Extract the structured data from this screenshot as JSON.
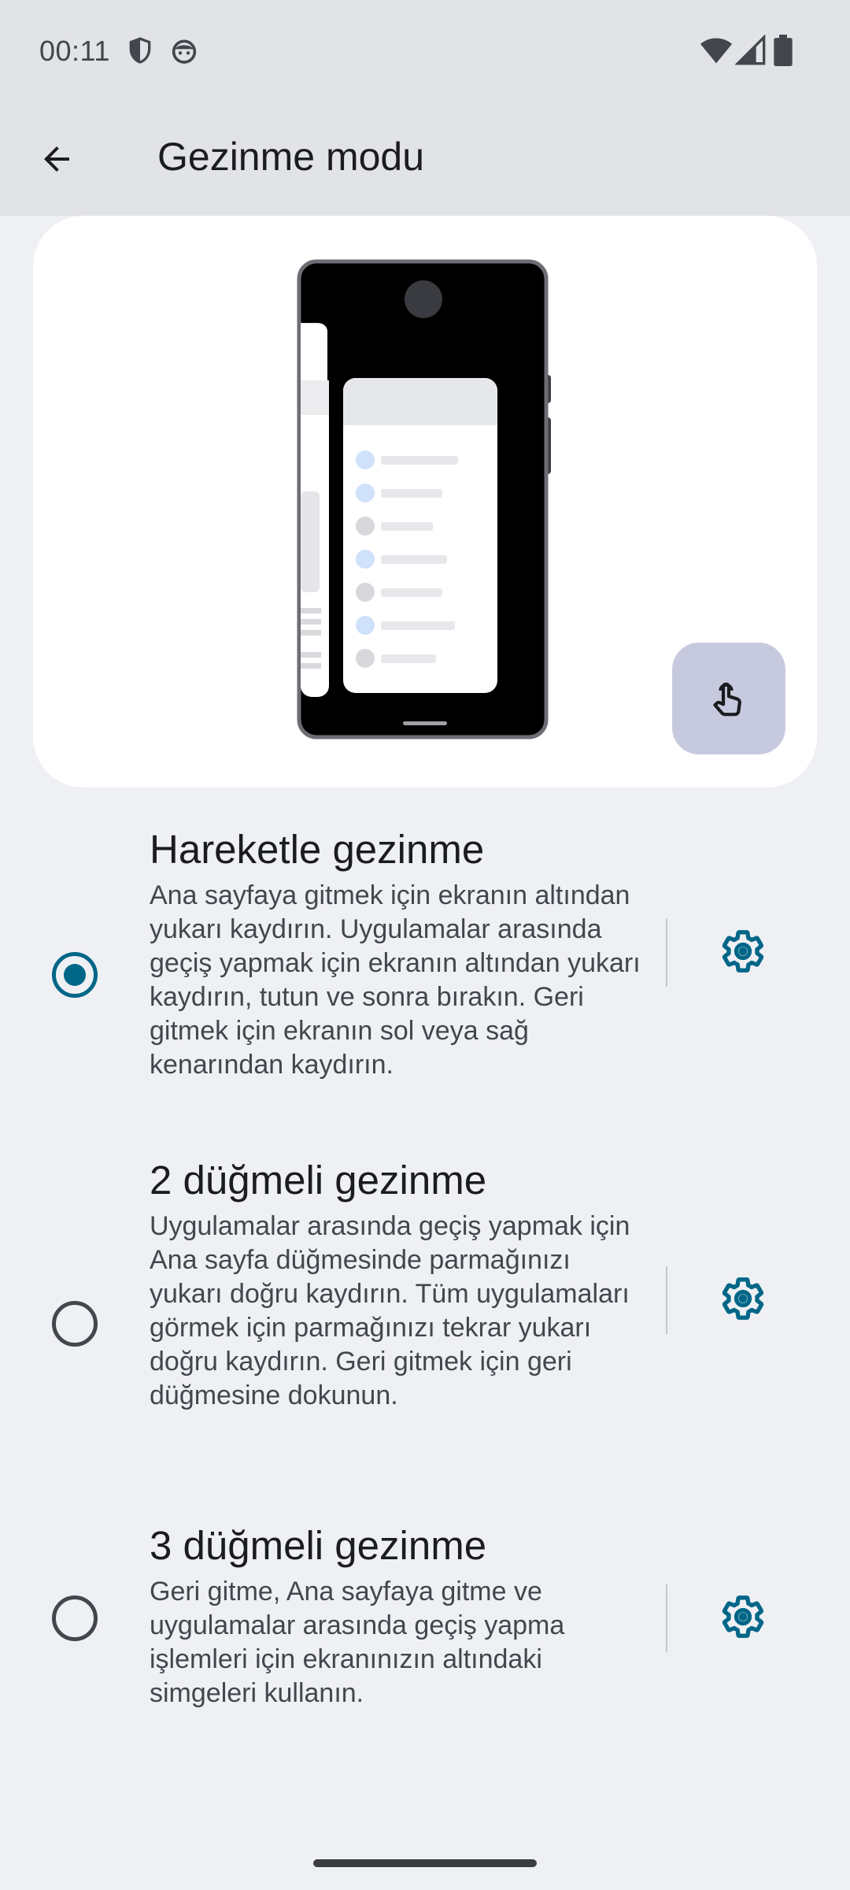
{
  "status_bar": {
    "time": "00:11",
    "left_icons": [
      "shield-icon",
      "face-icon"
    ],
    "right_icons": [
      "wifi-icon",
      "signal-icon",
      "battery-icon"
    ]
  },
  "app_bar": {
    "title": "Gezinme modu",
    "back_icon": "arrow-back-icon"
  },
  "illustration": {
    "gesture_button_icon": "touch-hand-icon"
  },
  "options": [
    {
      "title": "Hareketle gezinme",
      "description": "Ana sayfaya gitmek için ekranın altından yukarı kaydırın. Uygulamalar arasında geçiş yapmak için ekranın altından yukarı kaydırın, tutun ve sonra bırakın. Geri gitmek için ekranın sol veya sağ kenarından kaydırın.",
      "selected": true,
      "settings_icon": "gear-icon"
    },
    {
      "title": "2 düğmeli gezinme",
      "description": "Uygulamalar arasında geçiş yapmak için Ana sayfa düğmesinde parmağınızı yukarı doğru kaydırın. Tüm uygulamaları görmek için parmağınızı tekrar yukarı doğru kaydırın. Geri gitmek için geri düğmesine dokunun.",
      "selected": false,
      "settings_icon": "gear-icon"
    },
    {
      "title": "3 düğmeli gezinme",
      "description": "Geri gitme, Ana sayfaya gitme ve uygulamalar arasında geçiş yapma işlemleri için ekranınızın altındaki simgeleri kullanın.",
      "selected": false,
      "settings_icon": "gear-icon"
    }
  ],
  "colors": {
    "accent": "#006687",
    "background": "#eff0f4",
    "app_bar": "#e2e3e7",
    "gesture_button": "#c7cadf"
  }
}
